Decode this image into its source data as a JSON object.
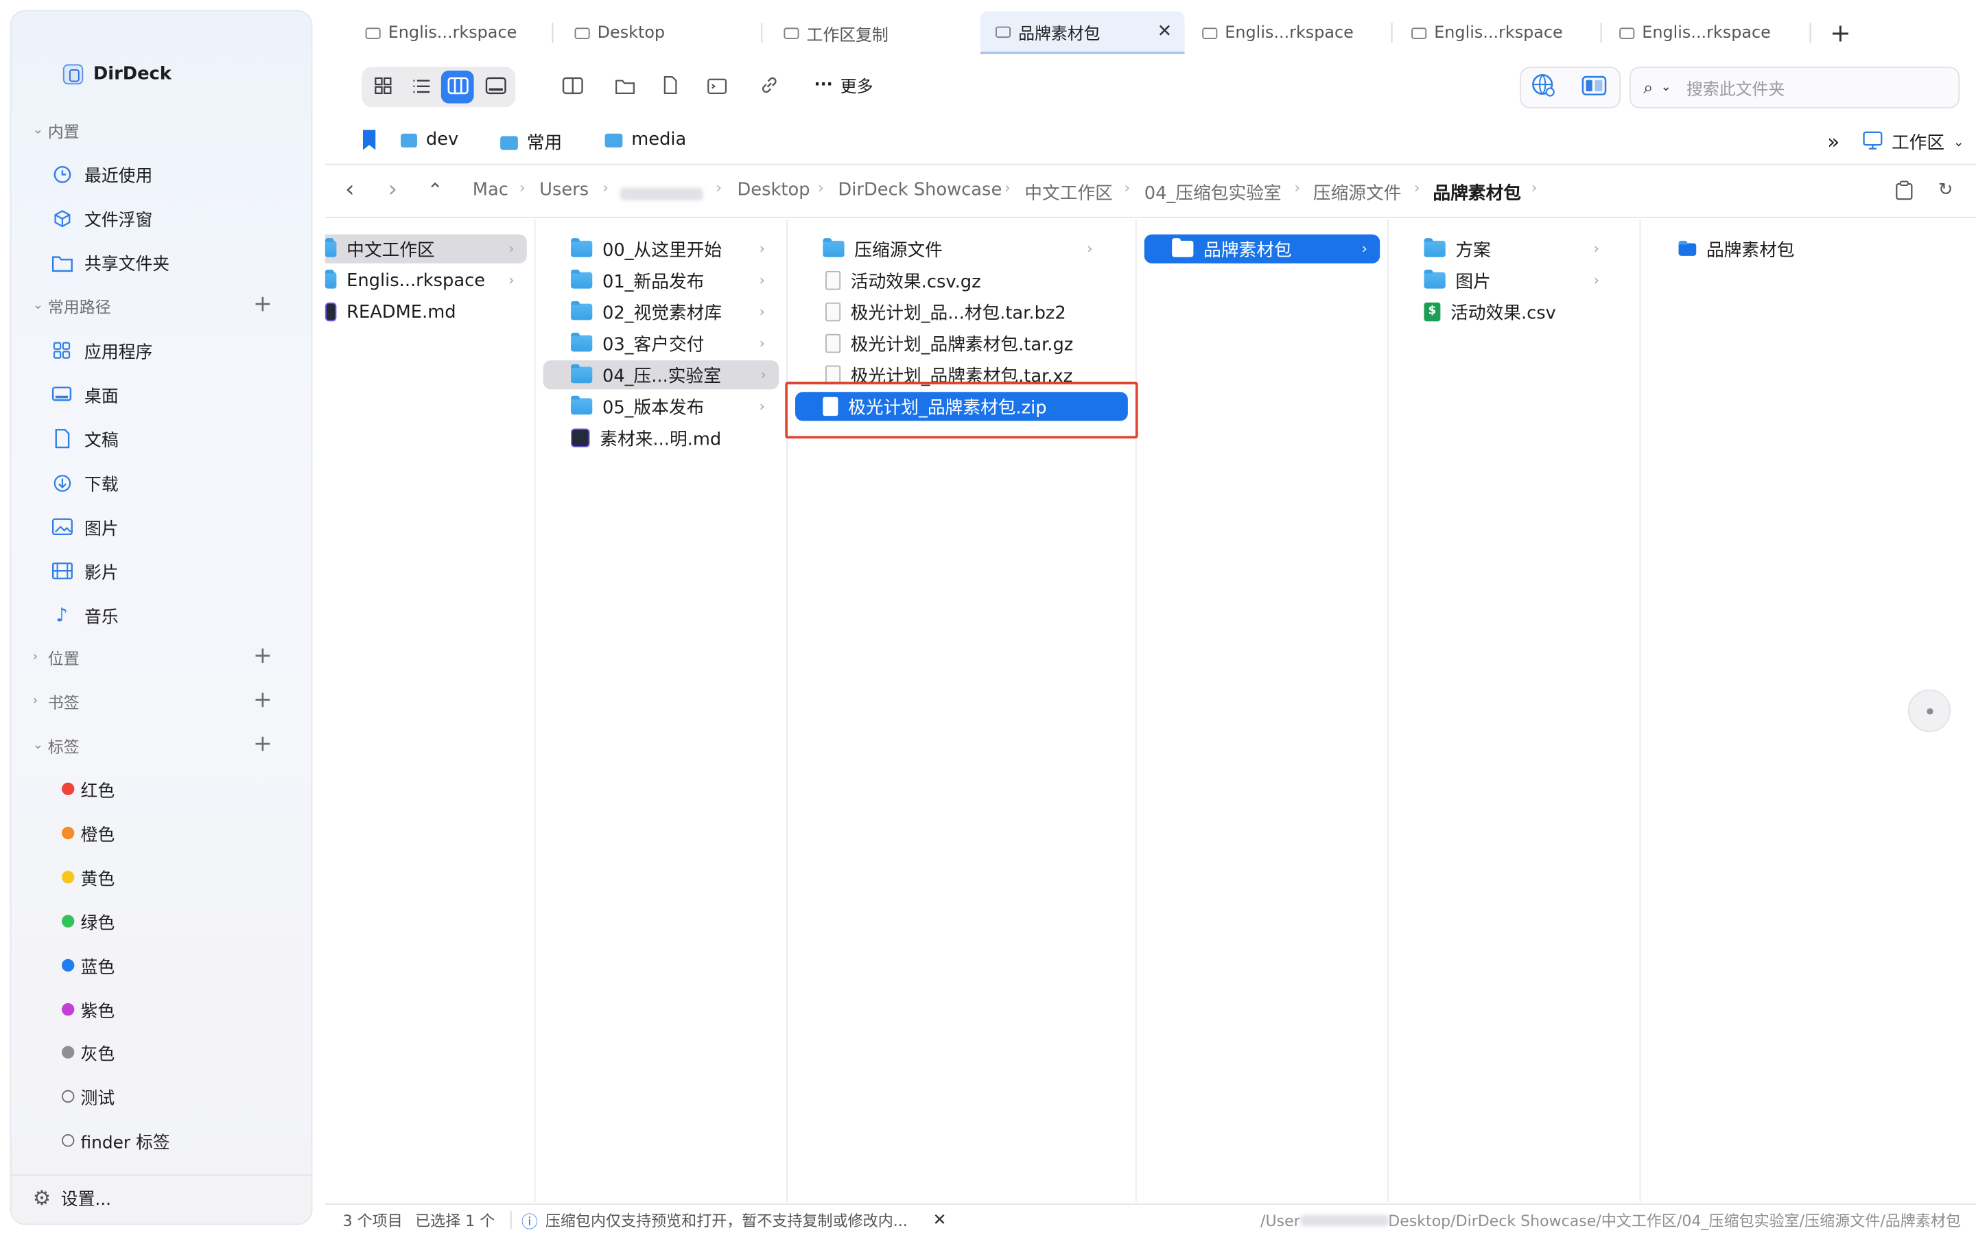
{
  "app": {
    "name": "DirDeck"
  },
  "sidebar": {
    "sections": [
      {
        "label": "内置"
      },
      {
        "label": "常用路径"
      },
      {
        "label": "位置"
      },
      {
        "label": "书签"
      },
      {
        "label": "标签"
      }
    ],
    "builtin": [
      {
        "label": "最近使用",
        "icon": "clock-icon"
      },
      {
        "label": "文件浮窗",
        "icon": "cube-icon"
      },
      {
        "label": "共享文件夹",
        "icon": "shared-folder-icon"
      }
    ],
    "paths": [
      {
        "label": "应用程序",
        "icon": "apps-icon"
      },
      {
        "label": "桌面",
        "icon": "desktop-icon"
      },
      {
        "label": "文稿",
        "icon": "document-icon"
      },
      {
        "label": "下载",
        "icon": "download-icon"
      },
      {
        "label": "图片",
        "icon": "photos-icon"
      },
      {
        "label": "影片",
        "icon": "film-icon"
      },
      {
        "label": "音乐",
        "icon": "music-icon"
      }
    ],
    "tags": [
      {
        "label": "红色",
        "color": "#f0443a"
      },
      {
        "label": "橙色",
        "color": "#f68a2c"
      },
      {
        "label": "黄色",
        "color": "#f7c51c"
      },
      {
        "label": "绿色",
        "color": "#34c25a"
      },
      {
        "label": "蓝色",
        "color": "#1f7ef2"
      },
      {
        "label": "紫色",
        "color": "#c33fd6"
      },
      {
        "label": "灰色",
        "color": "#8e8e93"
      },
      {
        "label": "测试",
        "color": ""
      },
      {
        "label": "finder 标签",
        "color": ""
      }
    ],
    "settings": "设置..."
  },
  "tabs": [
    {
      "label": "Englis...rkspace"
    },
    {
      "label": "Desktop"
    },
    {
      "label": "工作区复制"
    },
    {
      "label": "品牌素材包",
      "active": true
    },
    {
      "label": "Englis...rkspace"
    },
    {
      "label": "Englis...rkspace"
    },
    {
      "label": "Englis...rkspace"
    }
  ],
  "toolbar": {
    "more": "更多",
    "search_placeholder": "搜索此文件夹"
  },
  "bookmarks": [
    {
      "label": "dev"
    },
    {
      "label": "常用"
    },
    {
      "label": "media"
    }
  ],
  "workspace": "工作区",
  "breadcrumb": [
    "Mac",
    "Users",
    "Desktop",
    "DirDeck Showcase",
    "中文工作区",
    "04_压缩包实验室",
    "压缩源文件",
    "品牌素材包"
  ],
  "columns": {
    "col1": [
      {
        "label": "中文工作区",
        "type": "folder",
        "selected": true
      },
      {
        "label": "Englis...rkspace",
        "type": "folder"
      },
      {
        "label": "README.md",
        "type": "md"
      }
    ],
    "col2": [
      {
        "label": "00_从这里开始"
      },
      {
        "label": "01_新品发布"
      },
      {
        "label": "02_视觉素材库"
      },
      {
        "label": "03_客户交付"
      },
      {
        "label": "04_压...实验室",
        "selected": true
      },
      {
        "label": "05_版本发布"
      },
      {
        "label": "素材来...明.md",
        "type": "md"
      }
    ],
    "col3": [
      {
        "label": "压缩源文件",
        "type": "folder"
      },
      {
        "label": "活动效果.csv.gz",
        "type": "file"
      },
      {
        "label": "极光计划_品...材包.tar.bz2",
        "type": "file"
      },
      {
        "label": "极光计划_品牌素材包.tar.gz",
        "type": "file"
      },
      {
        "label": "极光计划_品牌素材包.tar.xz",
        "type": "file"
      },
      {
        "label": "极光计划_品牌素材包.zip",
        "type": "file",
        "highlight": true
      }
    ],
    "col4": [
      {
        "label": "品牌素材包"
      }
    ],
    "col5": [
      {
        "label": "方案",
        "type": "folder"
      },
      {
        "label": "图片",
        "type": "folder"
      },
      {
        "label": "活动效果.csv",
        "type": "csv"
      }
    ],
    "col6": [
      {
        "label": "品牌素材包"
      }
    ]
  },
  "status": {
    "count": "3 个项目",
    "selected": "已选择 1 个",
    "notice": "压缩包内仅支持预览和打开，暂不支持复制或修改内...",
    "path_prefix": "/User",
    "path": "Desktop/DirDeck Showcase/中文工作区/04_压缩包实验室/压缩源文件/品牌素材包"
  }
}
